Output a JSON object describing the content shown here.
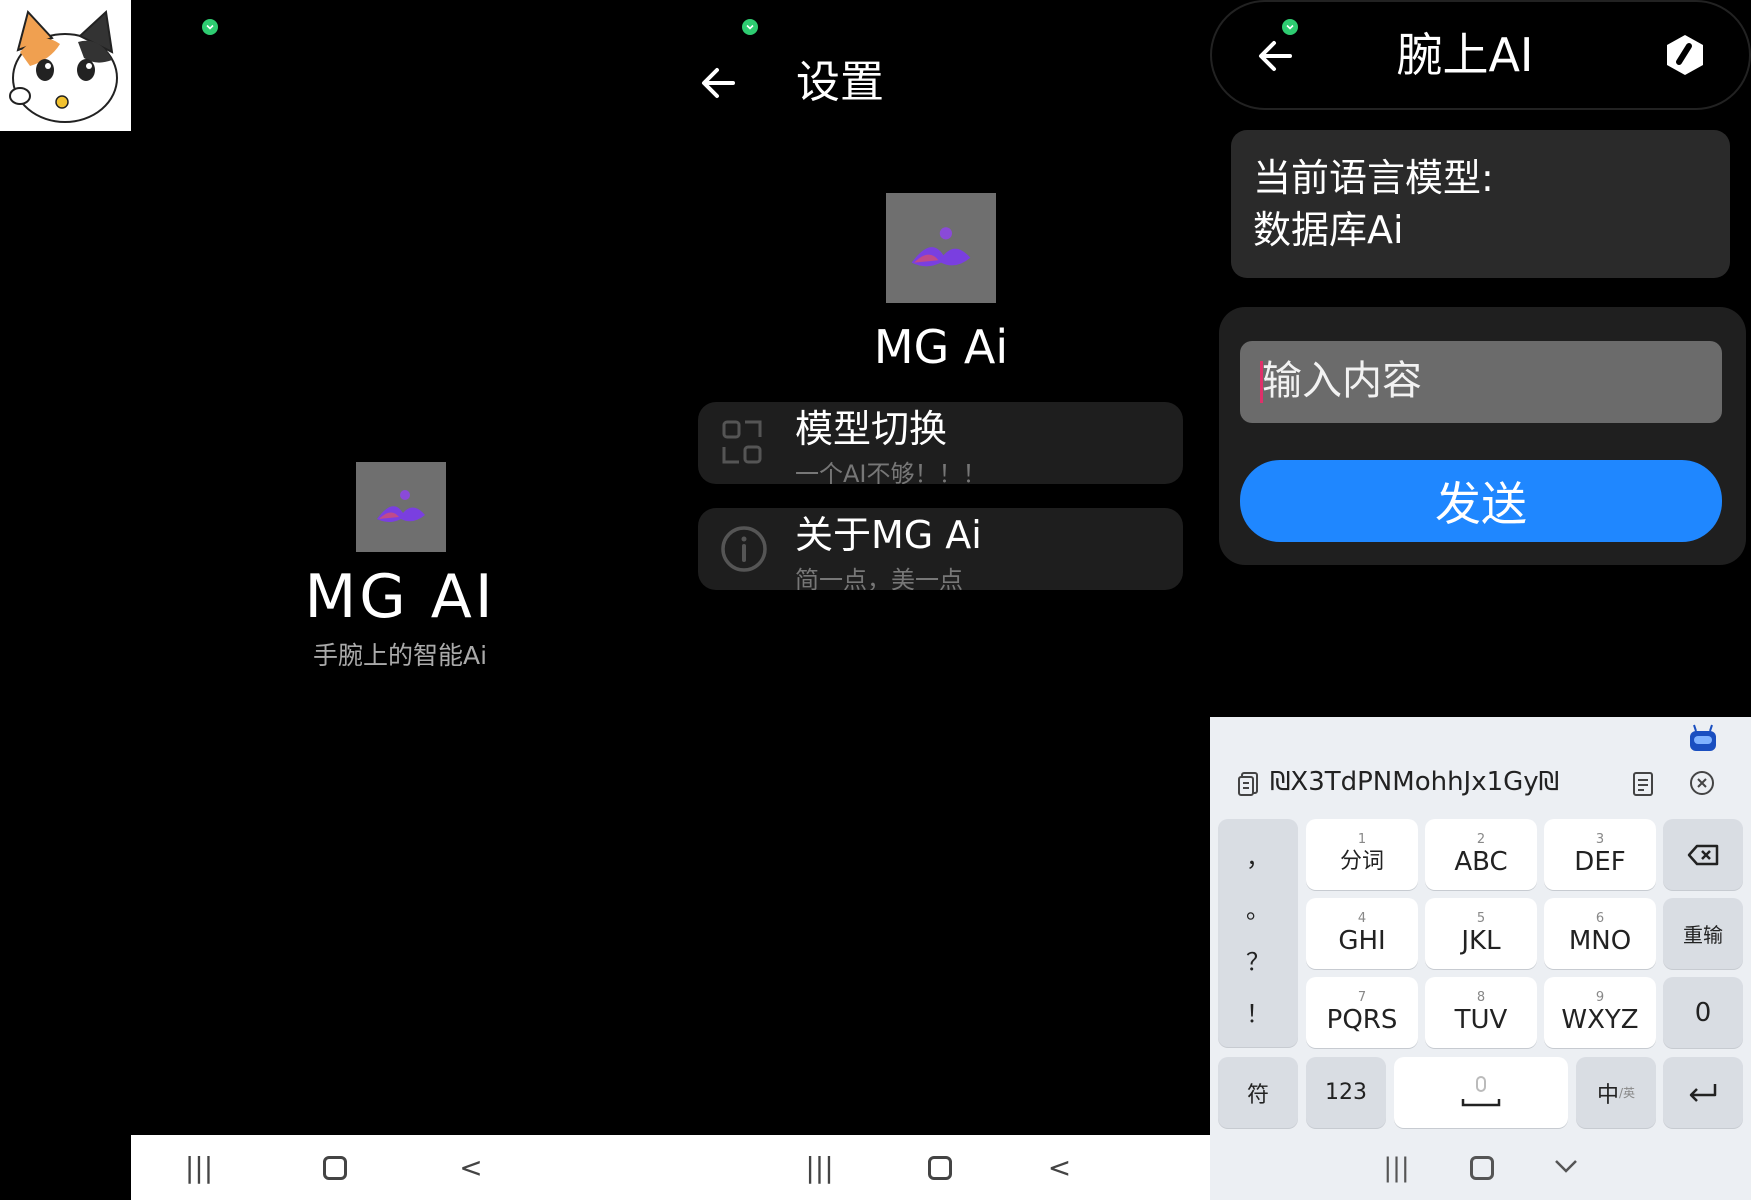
{
  "screen1": {
    "app_title": "MG AI",
    "tagline": "手腕上的智能Ai"
  },
  "screen2": {
    "title": "设置",
    "app_name": "MG Ai",
    "items": [
      {
        "title": "模型切换",
        "subtitle": "一个AI不够！！！"
      },
      {
        "title": "关于MG Ai",
        "subtitle": "简一点，美一点"
      }
    ]
  },
  "screen3": {
    "title": "腕上AI",
    "model_label": "当前语言模型:",
    "model_value": "数据库Ai",
    "input_placeholder": "输入内容",
    "send_label": "发送",
    "keyboard": {
      "suggestion": "₪X3TdPNMohhJx1Gy₪",
      "left_col": [
        "，",
        "。",
        "？",
        "！"
      ],
      "rows": [
        [
          {
            "num": "1",
            "label": "分词"
          },
          {
            "num": "2",
            "label": "ABC"
          },
          {
            "num": "3",
            "label": "DEF"
          }
        ],
        [
          {
            "num": "4",
            "label": "GHI"
          },
          {
            "num": "5",
            "label": "JKL"
          },
          {
            "num": "6",
            "label": "MNO"
          }
        ],
        [
          {
            "num": "7",
            "label": "PQRS"
          },
          {
            "num": "8",
            "label": "TUV"
          },
          {
            "num": "9",
            "label": "WXYZ"
          }
        ]
      ],
      "reinput_label": "重输",
      "zero_label": "0",
      "symbol_label": "符",
      "num123_label": "123",
      "lang_label": "中",
      "lang_sub": "/英"
    }
  },
  "colors": {
    "accent_blue": "#1f87ff",
    "status_green": "#2ecc71",
    "card_bg": "#2a2a2a"
  }
}
